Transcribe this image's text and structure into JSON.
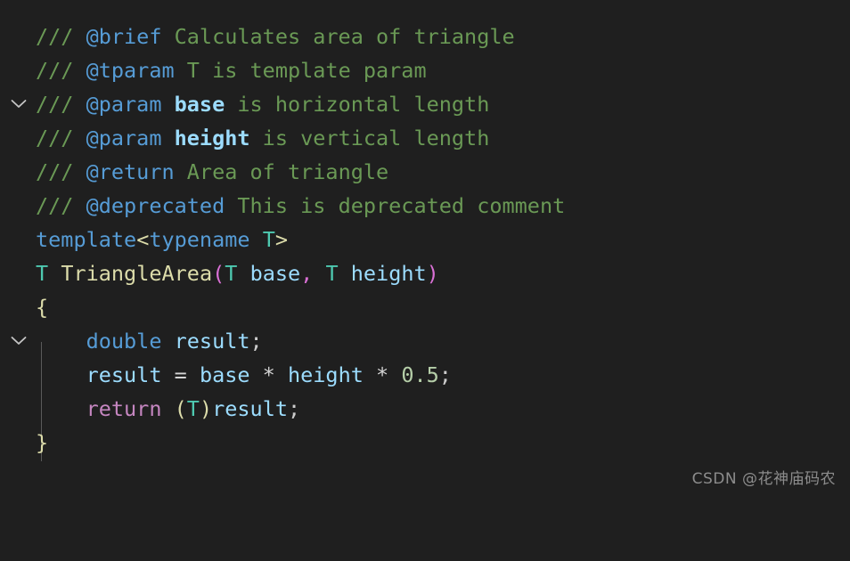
{
  "editor": {
    "background_color": "#1f1f1f",
    "language": "C++",
    "font_size_px": 23.5,
    "line_height_px": 38
  },
  "colors": {
    "comment": "#6a9955",
    "doc_tag": "#569cd6",
    "doc_param": "#9cdcfe",
    "keyword": "#569cd6",
    "type": "#4ec9b0",
    "function": "#dcdcaa",
    "variable": "#9cdcfe",
    "number": "#b5cea8",
    "control": "#c586c0",
    "bracket_yellow": "#dcdcaa",
    "bracket_purple": "#da70d6",
    "operator": "#d4d4d4",
    "indent_guide": "#5a5a5a",
    "fold_chevron": "#c5c5c5",
    "watermark": "#8c8c8c"
  },
  "gutter": {
    "fold_icon_name": "chevron-down-icon",
    "fold_rows": [
      0,
      8
    ]
  },
  "code": {
    "line1": {
      "slashes": "/// ",
      "tag": "@brief",
      "text": " Calculates area of triangle"
    },
    "line2": {
      "slashes": "/// ",
      "tag": "@tparam",
      "text": " T is template param"
    },
    "line3": {
      "slashes": "/// ",
      "tag": "@param",
      "space": " ",
      "param": "base",
      "text": " is horizontal length"
    },
    "line4": {
      "slashes": "/// ",
      "tag": "@param",
      "space": " ",
      "param": "height",
      "text": " is vertical length"
    },
    "line5": {
      "slashes": "/// ",
      "tag": "@return",
      "text": " Area of triangle"
    },
    "line6": {
      "slashes": "/// ",
      "tag": "@deprecated",
      "text": " This is deprecated comment"
    },
    "line7": {
      "kw_template": "template",
      "lt": "<",
      "kw_typename": "typename",
      "space": " ",
      "type_t": "T",
      "gt": ">"
    },
    "line8": {
      "ret_type": "T",
      "space": " ",
      "fn_name": "TriangleArea",
      "paren_open": "(",
      "p1_type": "T",
      "p1_space": " ",
      "p1_name": "base",
      "comma": ", ",
      "p2_type": "T",
      "p2_space": " ",
      "p2_name": "height",
      "paren_close": ")"
    },
    "line9": {
      "brace_open": "{"
    },
    "line10": {
      "indent": "    ",
      "kw_double": "double",
      "space": " ",
      "var": "result",
      "semi": ";"
    },
    "line11": {
      "indent": "    ",
      "var1": "result",
      "eq": " = ",
      "var2": "base",
      "mul1": " * ",
      "var3": "height",
      "mul2": " * ",
      "num": "0.5",
      "semi": ";"
    },
    "line12": {
      "indent": "    ",
      "kw_return": "return",
      "space": " ",
      "paren_open": "(",
      "cast_type": "T",
      "paren_close": ")",
      "var": "result",
      "semi": ";"
    },
    "line13": {
      "brace_close": "}"
    }
  },
  "watermark": {
    "text": "CSDN @花神庙码农"
  }
}
